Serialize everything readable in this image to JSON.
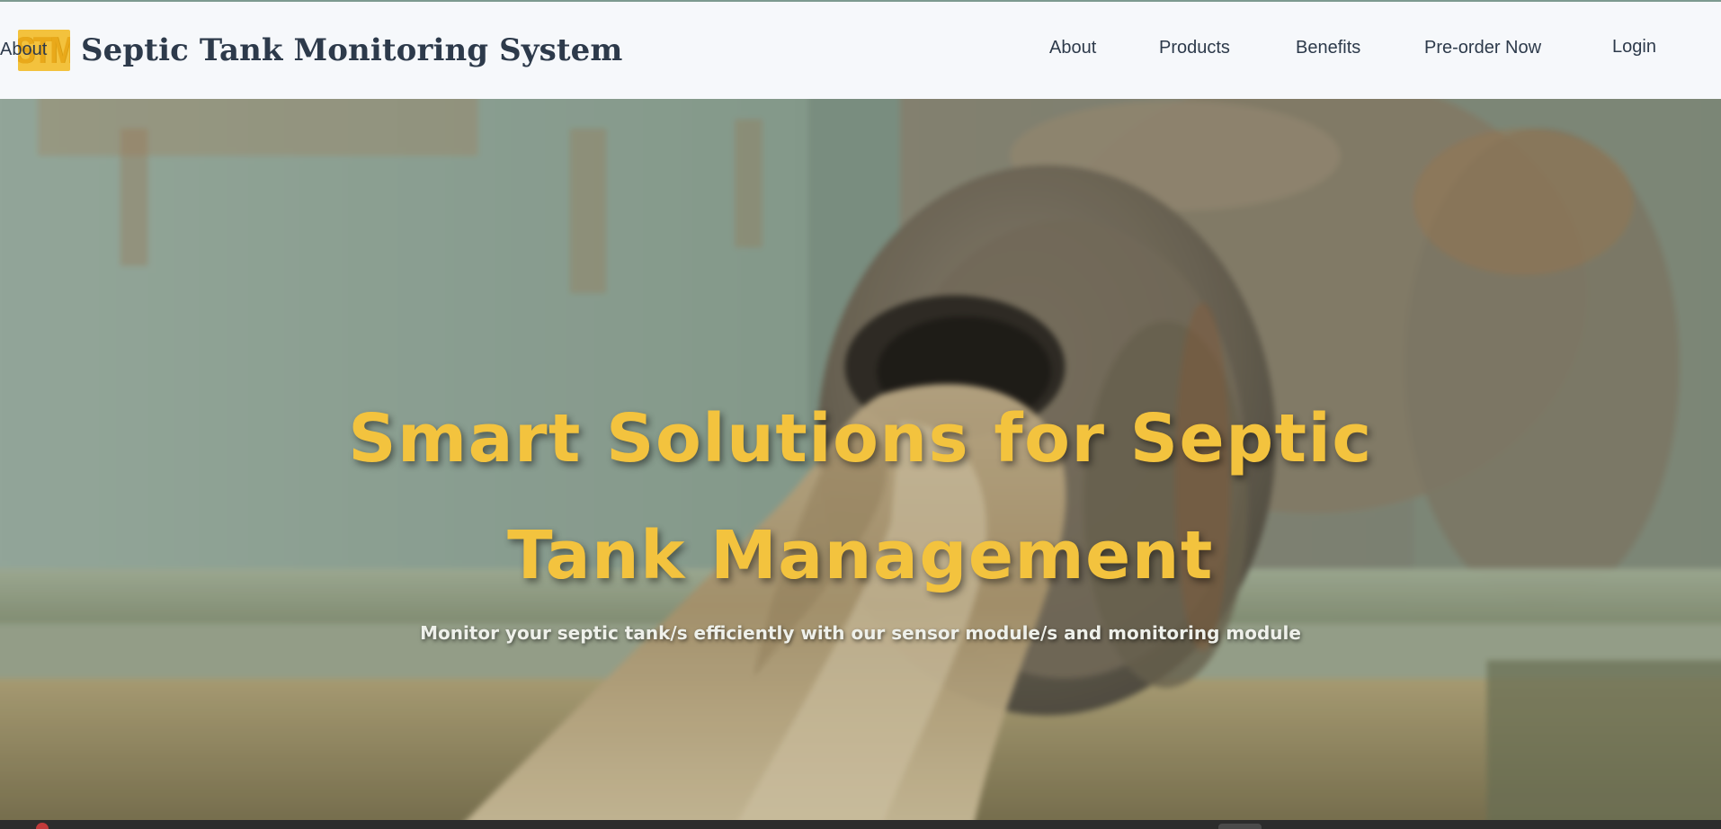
{
  "header": {
    "logo_text": "STM",
    "title": "Septic Tank Monitoring System",
    "nav": [
      {
        "label": "About"
      },
      {
        "label": "Products"
      },
      {
        "label": "Benefits"
      },
      {
        "label": "Pre-order Now"
      },
      {
        "label": "Login"
      }
    ]
  },
  "hero": {
    "title": "Smart Solutions for Septic Tank Management",
    "subtitle": "Monitor your septic tank/s efficiently with our sensor module/s and monitoring module",
    "background": "blurred photo of a rusty pipe discharging murky water",
    "colors": {
      "accent": "#f3c33e",
      "nav_text": "#2d3a4b",
      "header_bg": "#f6f8fb"
    }
  }
}
